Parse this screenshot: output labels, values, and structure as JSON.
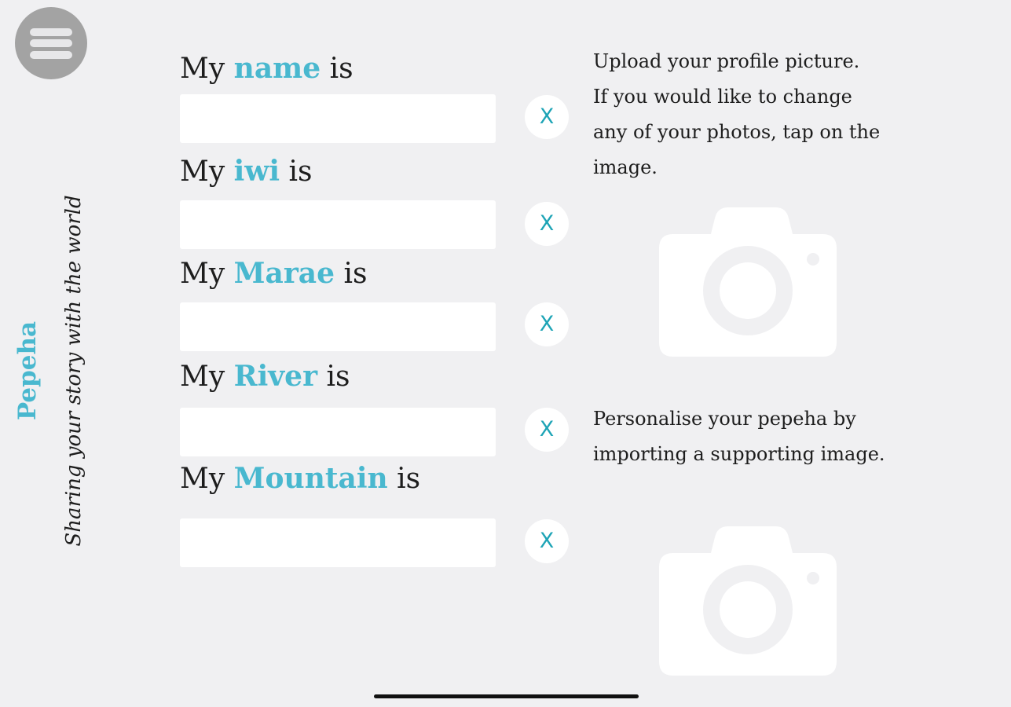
{
  "menu": {
    "icon": "hamburger-icon"
  },
  "brand": {
    "title": "Pepeha",
    "tagline": "Sharing your story with the world"
  },
  "fields": [
    {
      "prefix": "My",
      "keyword": "name",
      "suffix": "is",
      "value": "",
      "clear": "X"
    },
    {
      "prefix": "My",
      "keyword": "iwi",
      "suffix": "is",
      "value": "",
      "clear": "X"
    },
    {
      "prefix": "My",
      "keyword": "Marae",
      "suffix": "is",
      "value": "",
      "clear": "X"
    },
    {
      "prefix": "My",
      "keyword": "River",
      "suffix": "is",
      "value": "",
      "clear": "X"
    },
    {
      "prefix": "My",
      "keyword": "Mountain",
      "suffix": "is",
      "value": "",
      "clear": "X"
    }
  ],
  "profile_picture": {
    "line1": "Upload your profile picture.",
    "line2": "If you would like to change",
    "line3": "any of your photos, tap on the",
    "line4": "image.",
    "icon": "camera-icon"
  },
  "supporting_image": {
    "line1": "Personalise your pepeha by",
    "line2": "importing a supporting image.",
    "icon": "camera-icon"
  },
  "colors": {
    "accent": "#49b8cf",
    "clear": "#1ea4b6",
    "background": "#f0f0f2",
    "menu": "#a3a3a3"
  }
}
